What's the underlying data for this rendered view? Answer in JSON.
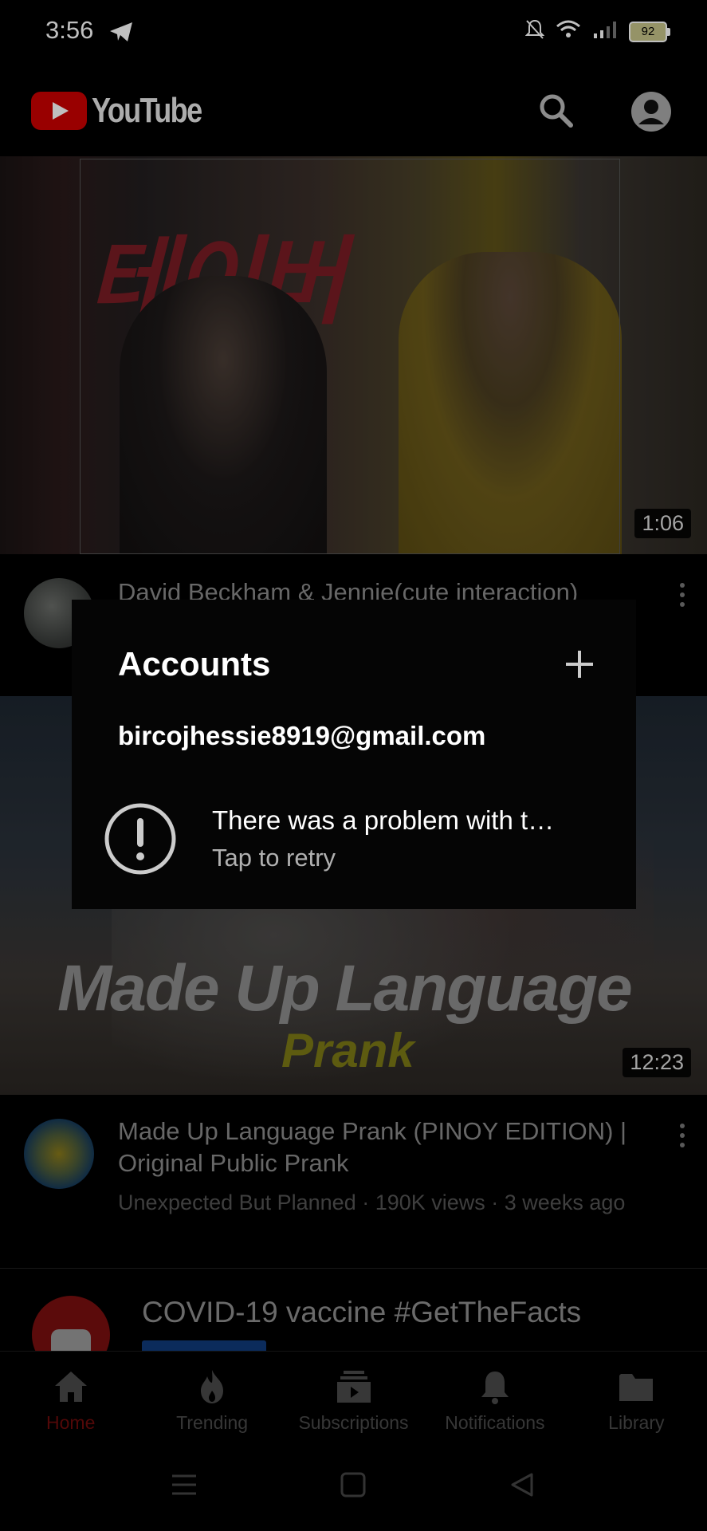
{
  "status_bar": {
    "time": "3:56",
    "battery": "92",
    "icons": [
      "telegram-icon",
      "mute-bell-icon",
      "wifi-icon",
      "signal-icon",
      "battery-icon"
    ]
  },
  "header": {
    "logo_text": "YouTube",
    "icons": [
      "search-icon",
      "account-icon"
    ]
  },
  "videos": [
    {
      "title": "David Beckham & Jennie(cute interaction)",
      "duration": "1:06",
      "thumbnail_text": "테이버"
    },
    {
      "title": "Made Up Language Prank (PINOY EDITION) | Original Public Prank",
      "channel": "Unexpected But Planned",
      "views": "190K views",
      "age": "3 weeks ago",
      "subtitle": "Unexpected But Planned · 190K views · 3 weeks ago",
      "duration": "12:23",
      "thumbnail_headline": "Made Up Language",
      "thumbnail_subheadline": "Prank"
    }
  ],
  "promo": {
    "title": "COVID-19 vaccine #GetTheFacts"
  },
  "accounts_popup": {
    "title": "Accounts",
    "email": "bircojhessie8919@gmail.com",
    "error_text": "There was a problem with t…",
    "retry_text": "Tap to retry"
  },
  "bottom_nav": [
    {
      "label": "Home",
      "icon": "home-icon",
      "active": true
    },
    {
      "label": "Trending",
      "icon": "flame-icon",
      "active": false
    },
    {
      "label": "Subscriptions",
      "icon": "subscriptions-icon",
      "active": false
    },
    {
      "label": "Notifications",
      "icon": "bell-icon",
      "active": false
    },
    {
      "label": "Library",
      "icon": "folder-icon",
      "active": false
    }
  ],
  "colors": {
    "accent": "#cc0000",
    "active_nav": "#6e0b0b",
    "background": "#000000"
  }
}
